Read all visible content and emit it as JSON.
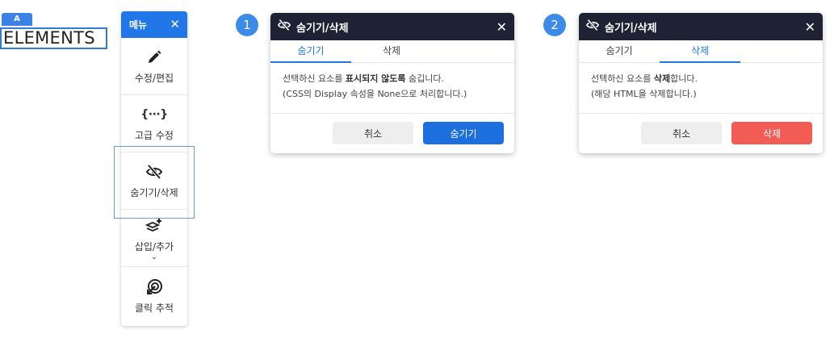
{
  "element_tag": {
    "badge": "A",
    "label": "ELEMENTS"
  },
  "menu": {
    "title": "메뉴",
    "close": "✕",
    "items": [
      {
        "label": "수정/편집",
        "icon": "pencil-icon"
      },
      {
        "label": "고급 수정",
        "icon": "code-braces-icon",
        "glyph": "{···}"
      },
      {
        "label": "숨기기/삭제",
        "icon": "eye-slash-icon"
      },
      {
        "label": "삽입/추가",
        "icon": "layers-plus-icon"
      },
      {
        "label": "클릭 추적",
        "icon": "click-target-icon"
      }
    ]
  },
  "dialogs": [
    {
      "step": "1",
      "title": "숨기기/삭제",
      "close": "✕",
      "tabs": [
        "숨기기",
        "삭제"
      ],
      "active_tab": 0,
      "body": {
        "line1_pre": "선택하신 요소를 ",
        "line1_bold": "표시되지 않도록",
        "line1_post": " 숨깁니다.",
        "line2": "(CSS의 Display 속성을 None으로 처리합니다.)"
      },
      "cancel": "취소",
      "confirm": "숨기기"
    },
    {
      "step": "2",
      "title": "숨기기/삭제",
      "close": "✕",
      "tabs": [
        "숨기기",
        "삭제"
      ],
      "active_tab": 1,
      "body": {
        "line1_pre": "선택하신 요소를 ",
        "line1_bold": "삭제",
        "line1_post": "합니다.",
        "line2": "(해당 HTML을 삭제합니다.)"
      },
      "cancel": "취소",
      "confirm": "삭제"
    }
  ],
  "colors": {
    "accent": "#2176e8",
    "dialog_header": "#1f2235",
    "confirm_blue": "#1d6fe0",
    "delete_red": "#f25c54",
    "step_bubble": "#3d8be8"
  }
}
